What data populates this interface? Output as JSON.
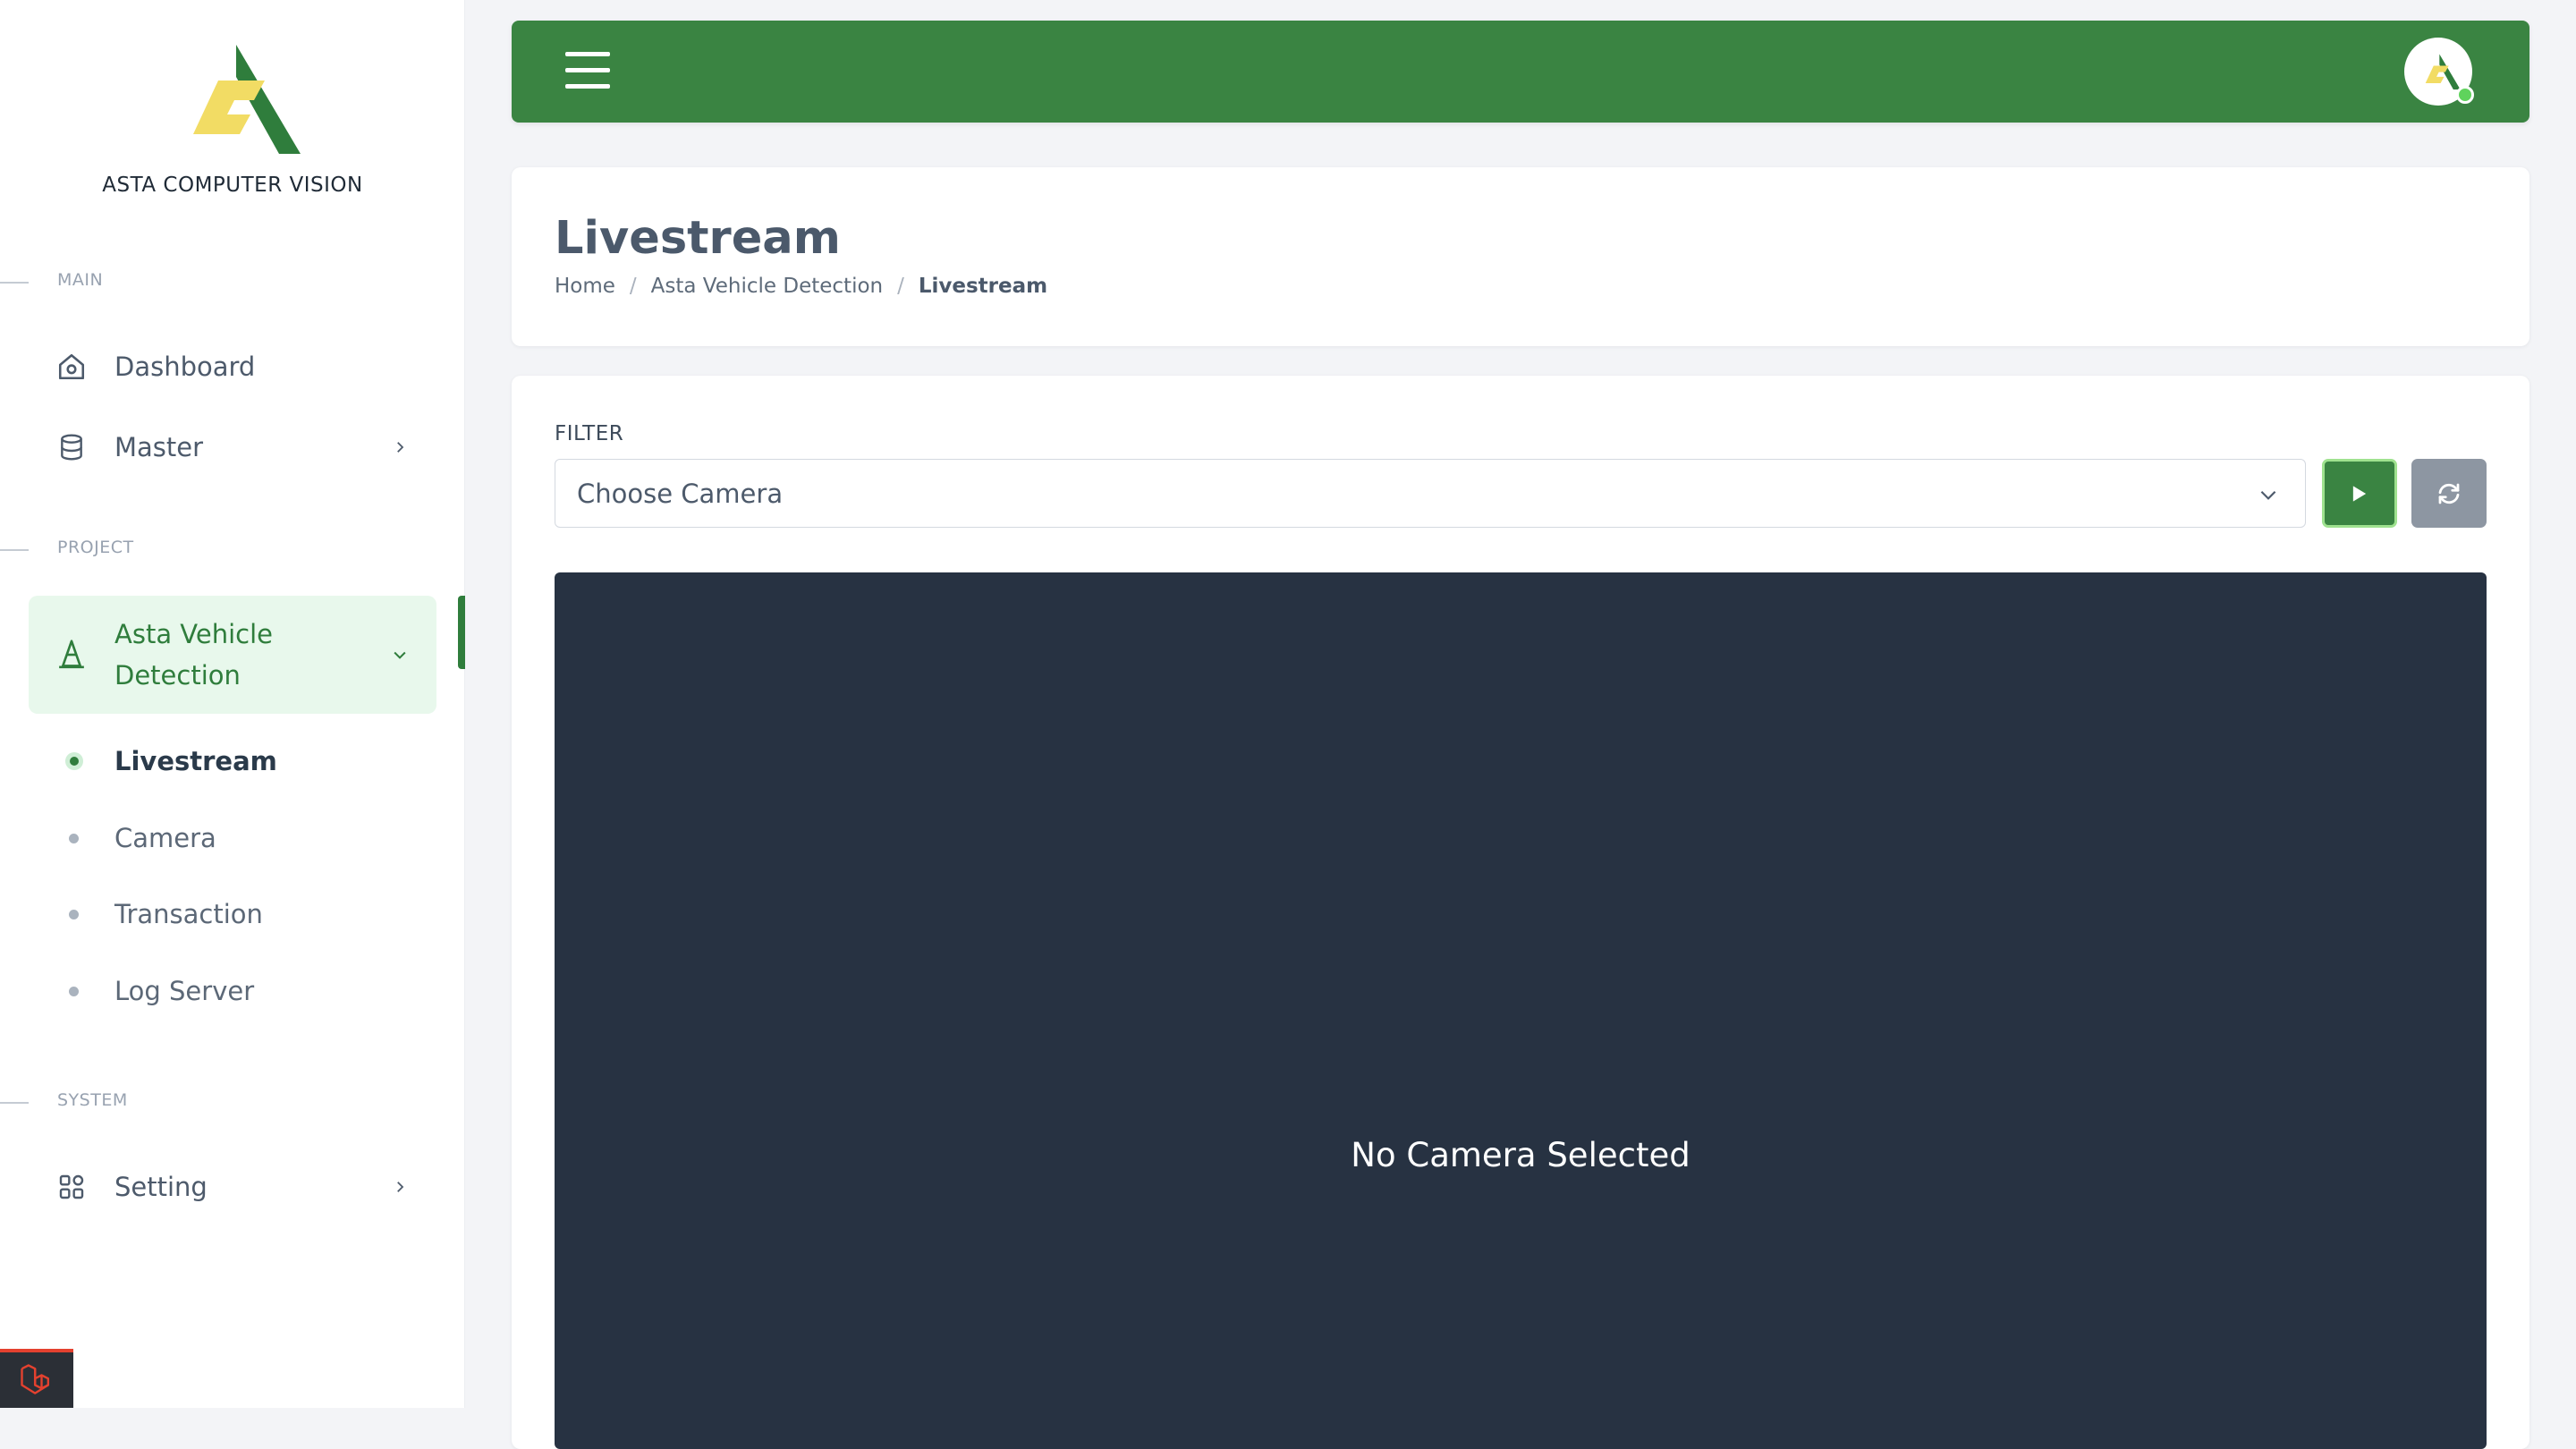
{
  "brand": {
    "name": "ASTA COMPUTER VISION",
    "logo_colors": {
      "green": "#2f7d3c",
      "yellow": "#f2dc64"
    }
  },
  "sidebar": {
    "sections": [
      {
        "label": "MAIN"
      },
      {
        "label": "PROJECT"
      },
      {
        "label": "SYSTEM"
      }
    ],
    "items": {
      "dashboard": {
        "label": "Dashboard",
        "icon": "home-icon"
      },
      "master": {
        "label": "Master",
        "icon": "database-icon"
      },
      "project": {
        "label_line1": "Asta Vehicle",
        "label_line2": "Detection",
        "icon": "traffic-cone-icon",
        "expanded": true
      },
      "setting": {
        "label": "Setting",
        "icon": "grid-icon"
      }
    },
    "subitems": [
      {
        "label": "Livestream",
        "current": true
      },
      {
        "label": "Camera",
        "current": false
      },
      {
        "label": "Transaction",
        "current": false
      },
      {
        "label": "Log Server",
        "current": false
      }
    ]
  },
  "topbar": {
    "color": "#3a8442"
  },
  "page": {
    "title": "Livestream",
    "breadcrumb": [
      "Home",
      "Asta Vehicle Detection",
      "Livestream"
    ]
  },
  "filter": {
    "label": "FILTER",
    "select_value": "Choose Camera"
  },
  "video": {
    "message": "No Camera Selected",
    "background": "#273242"
  }
}
